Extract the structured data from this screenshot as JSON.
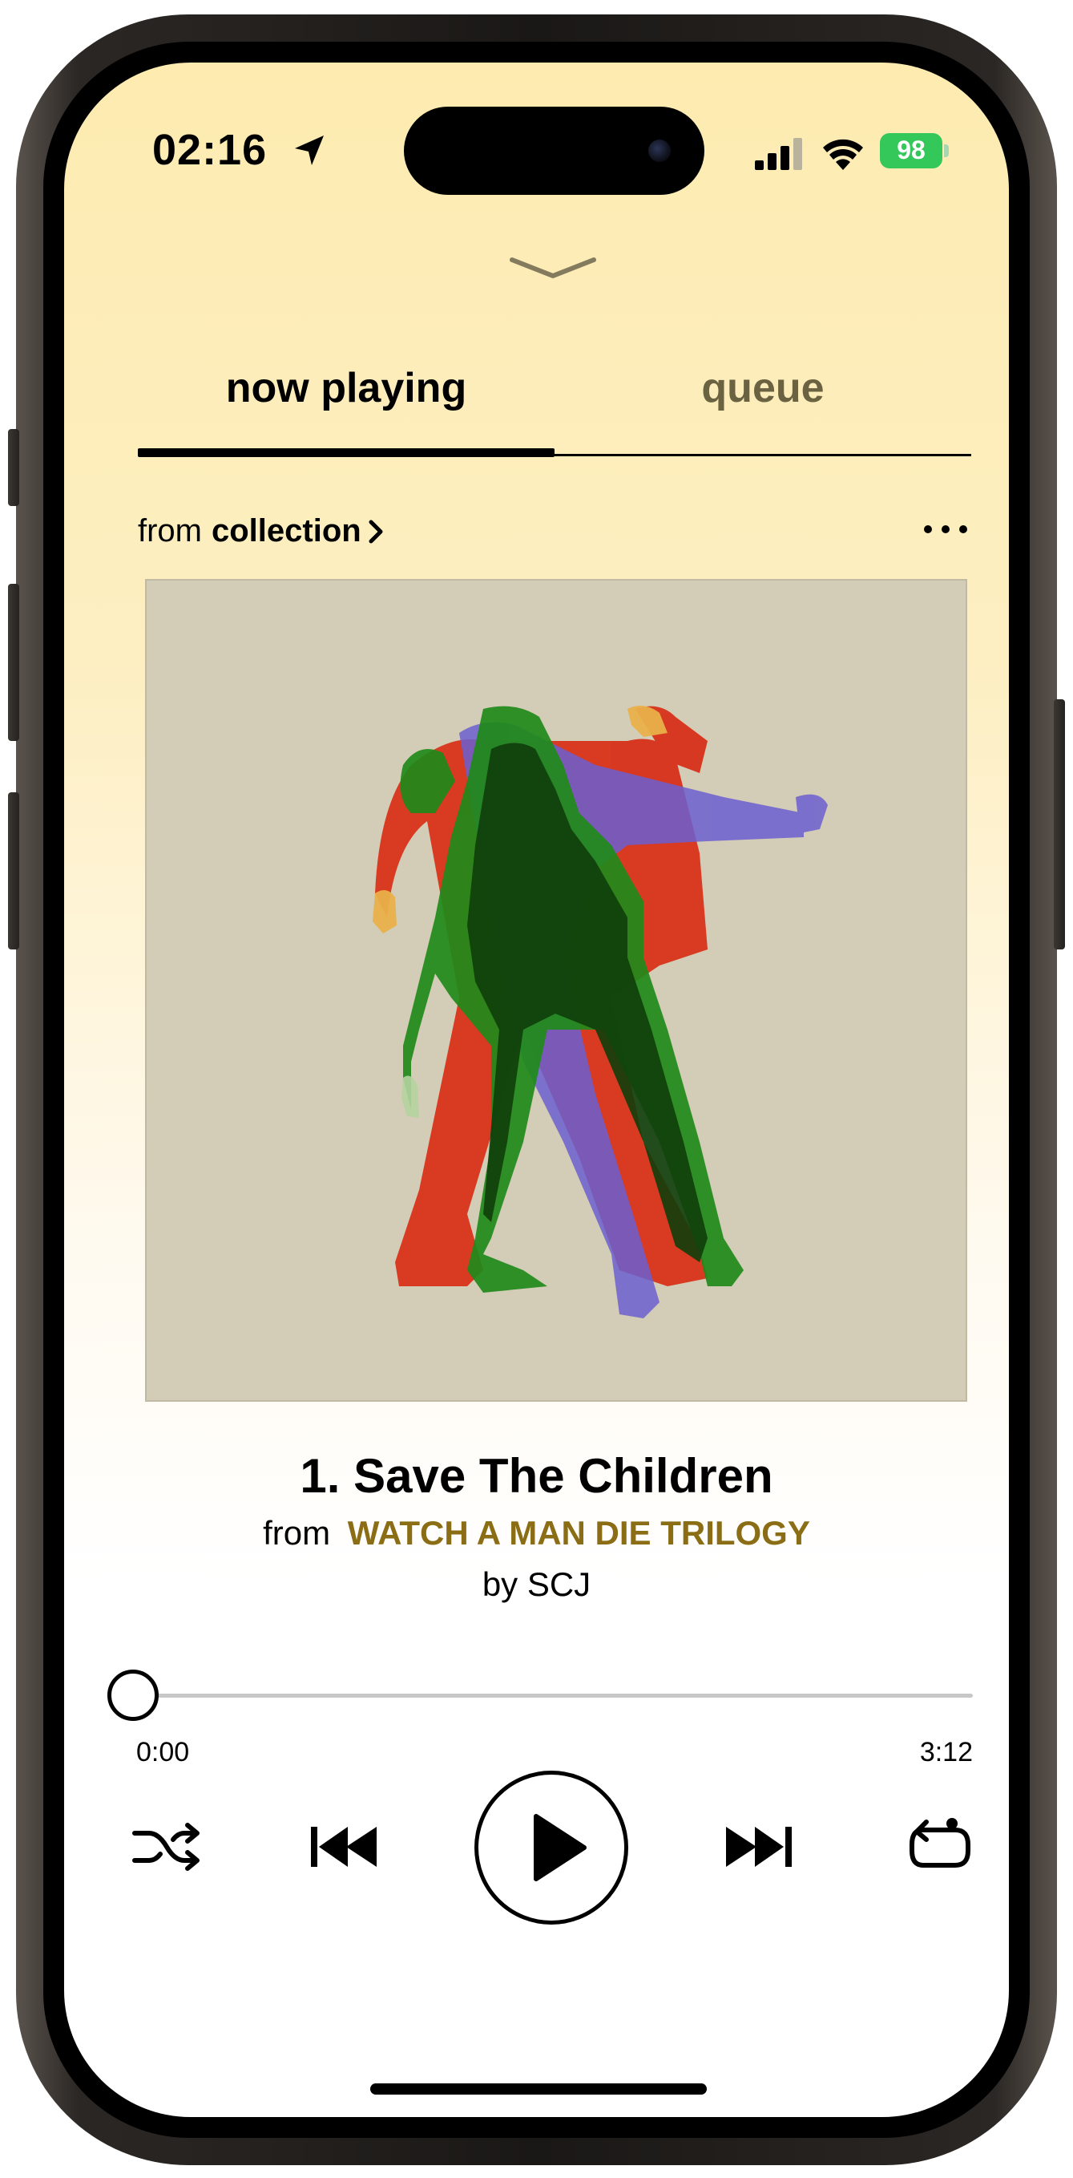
{
  "status_bar": {
    "time": "02:16",
    "battery_percent": "98",
    "icons": [
      "location-arrow-icon",
      "cellular-signal-icon",
      "wifi-icon",
      "battery-charging-icon"
    ]
  },
  "tabs": [
    {
      "label": "now playing",
      "active": true
    },
    {
      "label": "queue",
      "active": false
    }
  ],
  "source": {
    "prefix": "from",
    "name": "collection"
  },
  "track": {
    "title": "1. Save The Children",
    "album_prefix": "from",
    "album": "WATCH A MAN DIE TRILOGY",
    "artist_line": "by SCJ"
  },
  "playback": {
    "elapsed": "0:00",
    "duration": "3:12",
    "progress_fraction": 0.0
  },
  "colors": {
    "background_top": "#fdebb0",
    "album_accent": "#8a6d14",
    "art_background": "#d3ccb6",
    "battery": "#34c759",
    "queue_tab": "#6b6241"
  }
}
